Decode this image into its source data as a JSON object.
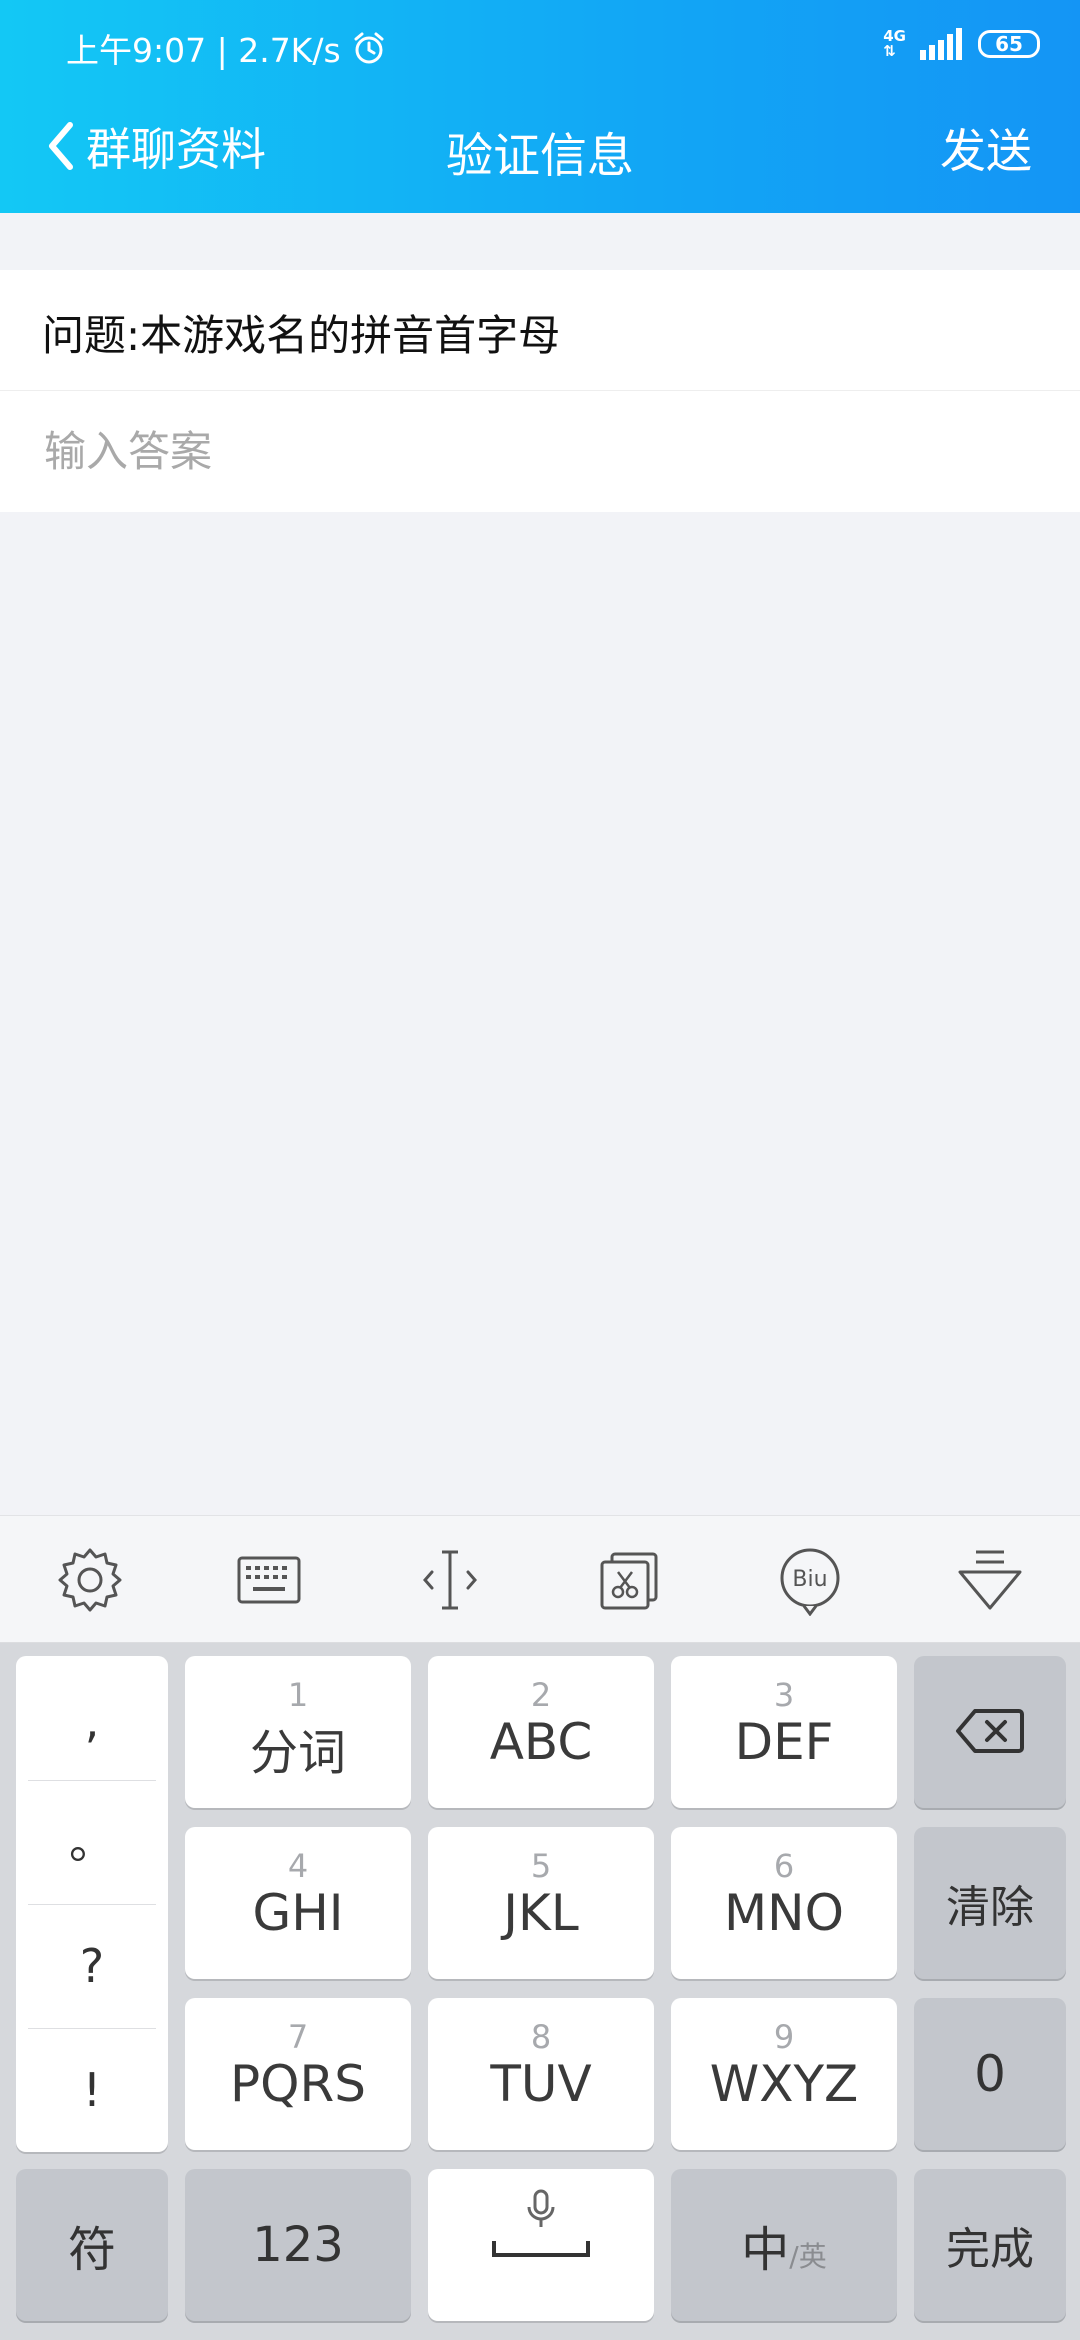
{
  "status_bar": {
    "time_speed": "上午9:07 | 2.7K/s",
    "network": "4G",
    "battery": "65"
  },
  "nav": {
    "back_label": "群聊资料",
    "title": "验证信息",
    "send_label": "发送"
  },
  "form": {
    "question": "问题:本游戏名的拼音首字母",
    "answer_placeholder": "输入答案",
    "answer_value": ""
  },
  "keyboard": {
    "toolbar": [
      "gear-icon",
      "keyboard-icon",
      "cursor-icon",
      "clipboard-icon",
      "biu-icon",
      "collapse-icon"
    ],
    "punctuation": [
      ",",
      "。",
      "?",
      "!"
    ],
    "keys": [
      {
        "num": "1",
        "label": "分词"
      },
      {
        "num": "2",
        "label": "ABC"
      },
      {
        "num": "3",
        "label": "DEF"
      },
      {
        "num": "4",
        "label": "GHI"
      },
      {
        "num": "5",
        "label": "JKL"
      },
      {
        "num": "6",
        "label": "MNO"
      },
      {
        "num": "7",
        "label": "PQRS"
      },
      {
        "num": "8",
        "label": "TUV"
      },
      {
        "num": "9",
        "label": "WXYZ"
      }
    ],
    "clear_label": "清除",
    "zero_label": "0",
    "symbol_label": "符",
    "numeric_label": "123",
    "lang_main": "中",
    "lang_sub": "/英",
    "done_label": "完成"
  }
}
